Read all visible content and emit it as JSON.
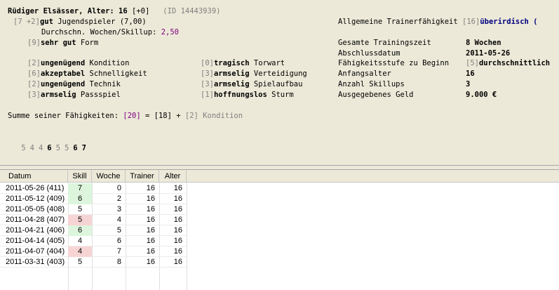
{
  "player": {
    "name_age_label": "Rüdiger Elsässer, Alter: ",
    "age": "16",
    "age_extra": " [+0]",
    "id": "(ID 14443939)"
  },
  "youth": {
    "prefix": "[7 +2]",
    "level": "gut",
    "text": " Jugendspieler (7,00)"
  },
  "avg_weeks": {
    "label": "Durchschn. Wochen/Skillup: ",
    "value": "2,50"
  },
  "form": {
    "prefix": "[9]",
    "level": "sehr gut",
    "text": " Form"
  },
  "skills_left": [
    {
      "prefix": "[2]",
      "level": "ungenügend",
      "name": " Kondition"
    },
    {
      "prefix": "[6]",
      "level": "akzeptabel",
      "name": " Schnelligkeit"
    },
    {
      "prefix": "[2]",
      "level": "ungenügend",
      "name": " Technik"
    },
    {
      "prefix": "[3]",
      "level": "armselig",
      "name": " Passspiel"
    }
  ],
  "skills_right": [
    {
      "prefix": "[0]",
      "level": "tragisch",
      "name": " Torwart"
    },
    {
      "prefix": "[3]",
      "level": "armselig",
      "name": " Verteidigung"
    },
    {
      "prefix": "[3]",
      "level": "armselig",
      "name": " Spielaufbau"
    },
    {
      "prefix": "[1]",
      "level": "hoffnungslos",
      "name": " Sturm"
    }
  ],
  "trainer": {
    "label": "Allgemeine Trainerfähigkeit ",
    "prefix": "[16]",
    "value": "überirdisch (",
    "rows": [
      {
        "label": "Gesamte Trainingszeit",
        "value": "8 Wochen"
      },
      {
        "label": "Abschlussdatum",
        "value": "2011-05-26"
      },
      {
        "label": "Fähigkeitsstufe zu Beginn",
        "prefix": "[5]",
        "value": "durchschnittlich"
      },
      {
        "label": "Anfangsalter",
        "value": "16"
      },
      {
        "label": "Anzahl Skillups",
        "value": "3"
      },
      {
        "label": "Ausgegebenes Geld",
        "value": "9.000 €"
      }
    ]
  },
  "sum": {
    "label": "Summe seiner Fähigkeiten: ",
    "total": "[20]",
    "eq": " = [18] + ",
    "tail": "[2] Kondition"
  },
  "history": [
    "5",
    "4",
    "4",
    "6",
    "5",
    "5",
    "6",
    "7"
  ],
  "table": {
    "headers": [
      "Datum",
      "Skill",
      "Woche",
      "Trainer",
      "Alter"
    ],
    "rows": [
      {
        "date": "2011-05-26 (411)",
        "skill": "7",
        "week": "0",
        "trainer": "16",
        "age": "16",
        "trend": "up"
      },
      {
        "date": "2011-05-12 (409)",
        "skill": "6",
        "week": "2",
        "trainer": "16",
        "age": "16",
        "trend": "up"
      },
      {
        "date": "2011-05-05 (408)",
        "skill": "5",
        "week": "3",
        "trainer": "16",
        "age": "16",
        "trend": "none"
      },
      {
        "date": "2011-04-28 (407)",
        "skill": "5",
        "week": "4",
        "trainer": "16",
        "age": "16",
        "trend": "down"
      },
      {
        "date": "2011-04-21 (406)",
        "skill": "6",
        "week": "5",
        "trainer": "16",
        "age": "16",
        "trend": "up"
      },
      {
        "date": "2011-04-14 (405)",
        "skill": "4",
        "week": "6",
        "trainer": "16",
        "age": "16",
        "trend": "none"
      },
      {
        "date": "2011-04-07 (404)",
        "skill": "4",
        "week": "7",
        "trainer": "16",
        "age": "16",
        "trend": "down"
      },
      {
        "date": "2011-03-31 (403)",
        "skill": "5",
        "week": "8",
        "trainer": "16",
        "age": "16",
        "trend": "none"
      }
    ]
  },
  "colors": {
    "panel_bg": "#ece9d8",
    "skill_up": "#dcf5dc",
    "skill_down": "#f7d4d4",
    "accent_purple": "#800080",
    "accent_navy": "#000080"
  }
}
